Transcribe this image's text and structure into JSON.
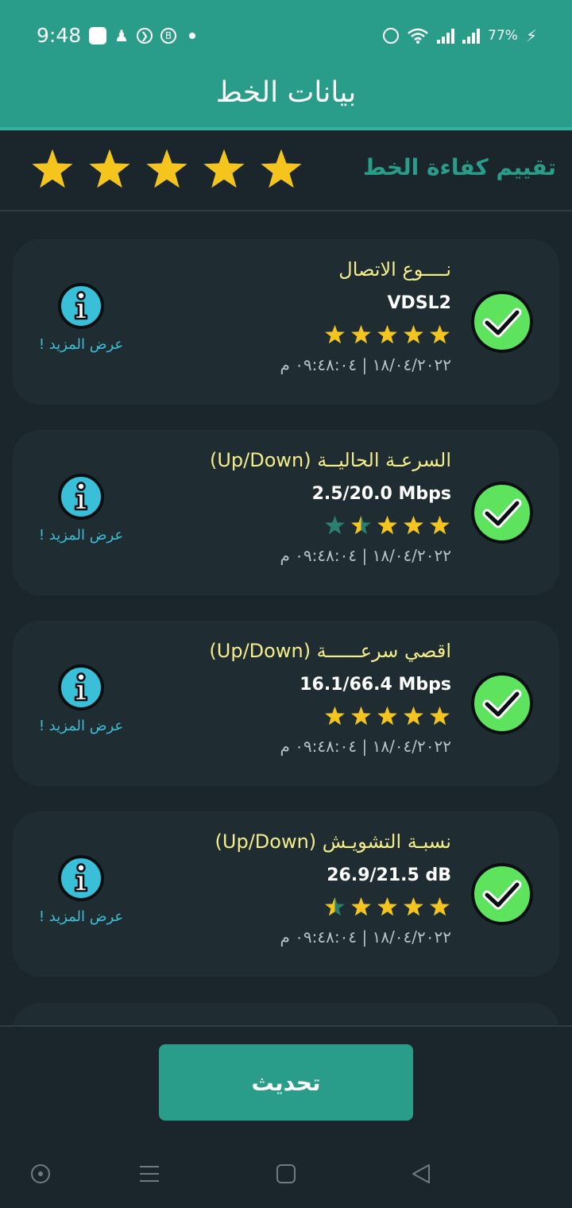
{
  "status_bar": {
    "time": "9:48",
    "battery": "77%",
    "left_icons": [
      "app-icon",
      "person-add-icon",
      "media-icon",
      "b-icon",
      "dot-icon"
    ],
    "right_icons": [
      "alarm-icon",
      "wifi-icon",
      "signal-icon",
      "signal-icon",
      "battery-charging-icon"
    ],
    "b_badge": "B"
  },
  "header": {
    "title": "بيانات الخط"
  },
  "line_rating": {
    "label": "تقييم كفاءة الخط",
    "stars": 5,
    "max_stars": 5
  },
  "cards": [
    {
      "title": "نــــوع الاتصال",
      "value": "VDSL2",
      "stars": 5,
      "timestamp": "١٨/٠٤/٢٠٢٢ | ٠٩:٤٨:٠٤ م",
      "more_label": "عرض المزيد !",
      "icon": "check-icon"
    },
    {
      "title": "السرعـة الحاليــة (Up/Down)",
      "value": "2.5/20.0 Mbps",
      "stars": 3.5,
      "timestamp": "١٨/٠٤/٢٠٢٢ | ٠٩:٤٨:٠٤ م",
      "more_label": "عرض المزيد !",
      "icon": "check-icon"
    },
    {
      "title": "اقصي سرعــــــة (Up/Down)",
      "value": "16.1/66.4 Mbps",
      "stars": 5,
      "timestamp": "١٨/٠٤/٢٠٢٢ | ٠٩:٤٨:٠٤ م",
      "more_label": "عرض المزيد !",
      "icon": "check-icon"
    },
    {
      "title": "نسبـة التشويـش (Up/Down)",
      "value": "26.9/21.5 dB",
      "stars": 4.5,
      "timestamp": "١٨/٠٤/٢٠٢٢ | ٠٩:٤٨:٠٤ م",
      "more_label": "عرض المزيد !",
      "icon": "check-icon"
    }
  ],
  "refresh_button": {
    "label": "تحديث"
  },
  "nav": {
    "items": [
      "recent-circle-icon",
      "menu-icon",
      "home-square-icon",
      "back-triangle-icon"
    ]
  },
  "colors": {
    "accent": "#2a9d8a",
    "background": "#1b262c",
    "card": "#1f2d33",
    "star": "#f6c51d",
    "star_empty": "#2a7f6e",
    "check": "#5ee35e",
    "info": "#39c0d8",
    "title": "#f4ed8a"
  }
}
